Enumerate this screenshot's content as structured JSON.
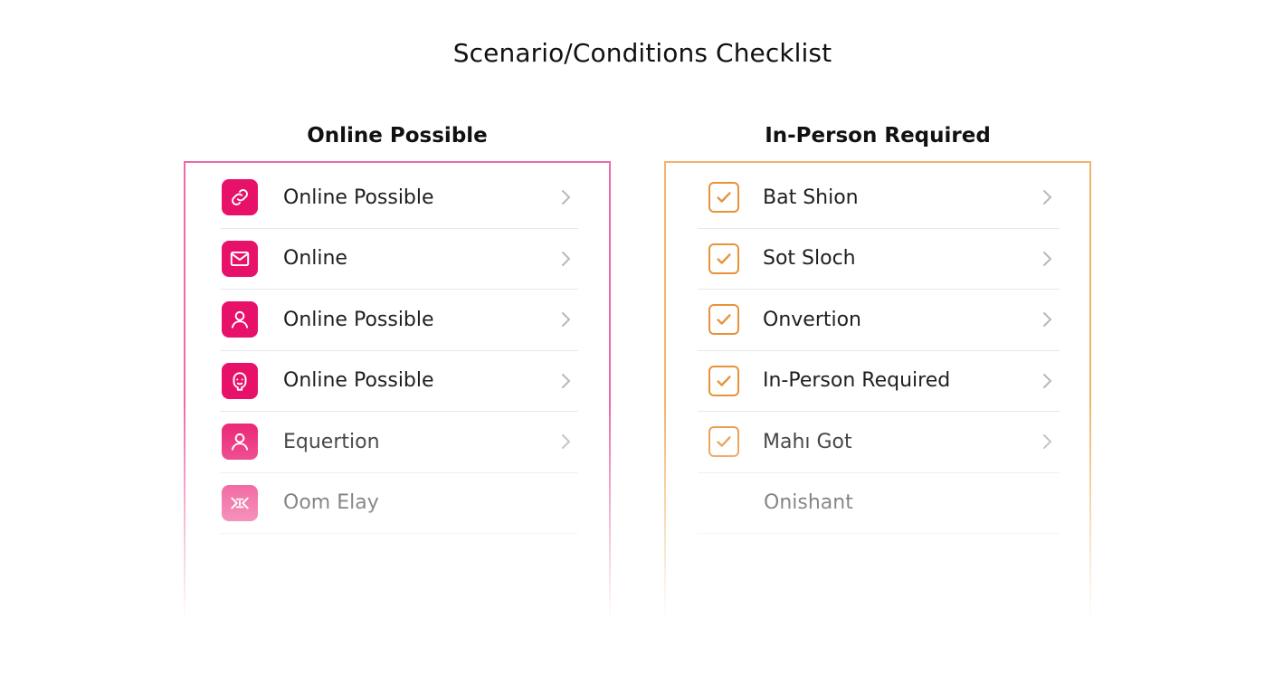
{
  "title": "Scenario/Conditions Checklist",
  "colors": {
    "online_accent": "#e8116a",
    "in_person_accent": "#e8923a"
  },
  "online": {
    "heading": "Online Possible",
    "items": [
      {
        "label": "Online Possible",
        "icon": "link-icon",
        "chevron": true
      },
      {
        "label": "Online",
        "icon": "mail-icon",
        "chevron": true
      },
      {
        "label": "Online Possible",
        "icon": "user-icon",
        "chevron": true
      },
      {
        "label": "Online Possible",
        "icon": "face-icon",
        "chevron": true
      },
      {
        "label": "Equertion",
        "icon": "user-icon",
        "chevron": true
      },
      {
        "label": "Oom Elay",
        "icon": "compress-icon",
        "chevron": false
      }
    ]
  },
  "in_person": {
    "heading": "In-Person Required",
    "items": [
      {
        "label": "Bat Shion",
        "checked": true,
        "chevron": true
      },
      {
        "label": "Sot Sloch",
        "checked": true,
        "chevron": true
      },
      {
        "label": "Onvertion",
        "checked": true,
        "chevron": true
      },
      {
        "label": "In-Person Required",
        "checked": true,
        "chevron": true
      },
      {
        "label": "Mahı Got",
        "checked": true,
        "chevron": true
      },
      {
        "label": "Onishant",
        "checked": false,
        "chevron": false
      }
    ]
  }
}
